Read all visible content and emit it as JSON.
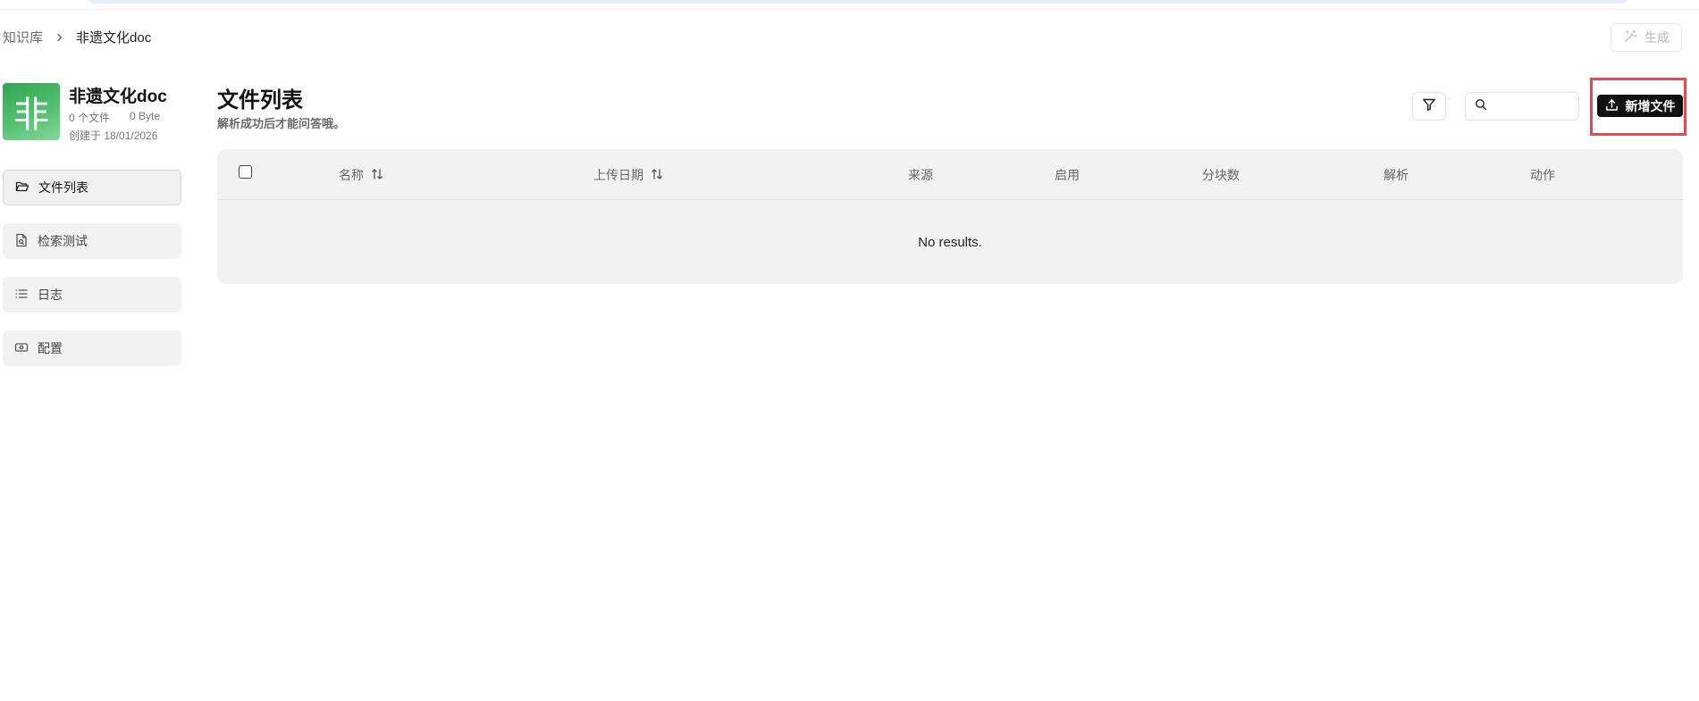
{
  "breadcrumb": {
    "root": "知识库",
    "current": "非遗文化doc"
  },
  "header": {
    "generate_label": "生成"
  },
  "dataset": {
    "avatar_char": "非",
    "name": "非遗文化doc",
    "file_count": "0 个文件",
    "size": "0 Byte",
    "created": "创建于 18/01/2026"
  },
  "sidebar": {
    "items": [
      {
        "label": "文件列表",
        "icon": "folder-open-icon"
      },
      {
        "label": "检索测试",
        "icon": "file-search-icon"
      },
      {
        "label": "日志",
        "icon": "list-icon"
      },
      {
        "label": "配置",
        "icon": "settings-card-icon"
      }
    ]
  },
  "main": {
    "title": "文件列表",
    "subtitle": "解析成功后才能问答哦。",
    "search_placeholder": "",
    "add_file_label": "新增文件"
  },
  "table": {
    "columns": [
      "名称",
      "上传日期",
      "来源",
      "启用",
      "分块数",
      "解析",
      "动作"
    ],
    "empty_text": "No results."
  },
  "colors": {
    "accent": "#111111",
    "highlight": "#e5484d",
    "avatar_green": "#3cb05d"
  }
}
